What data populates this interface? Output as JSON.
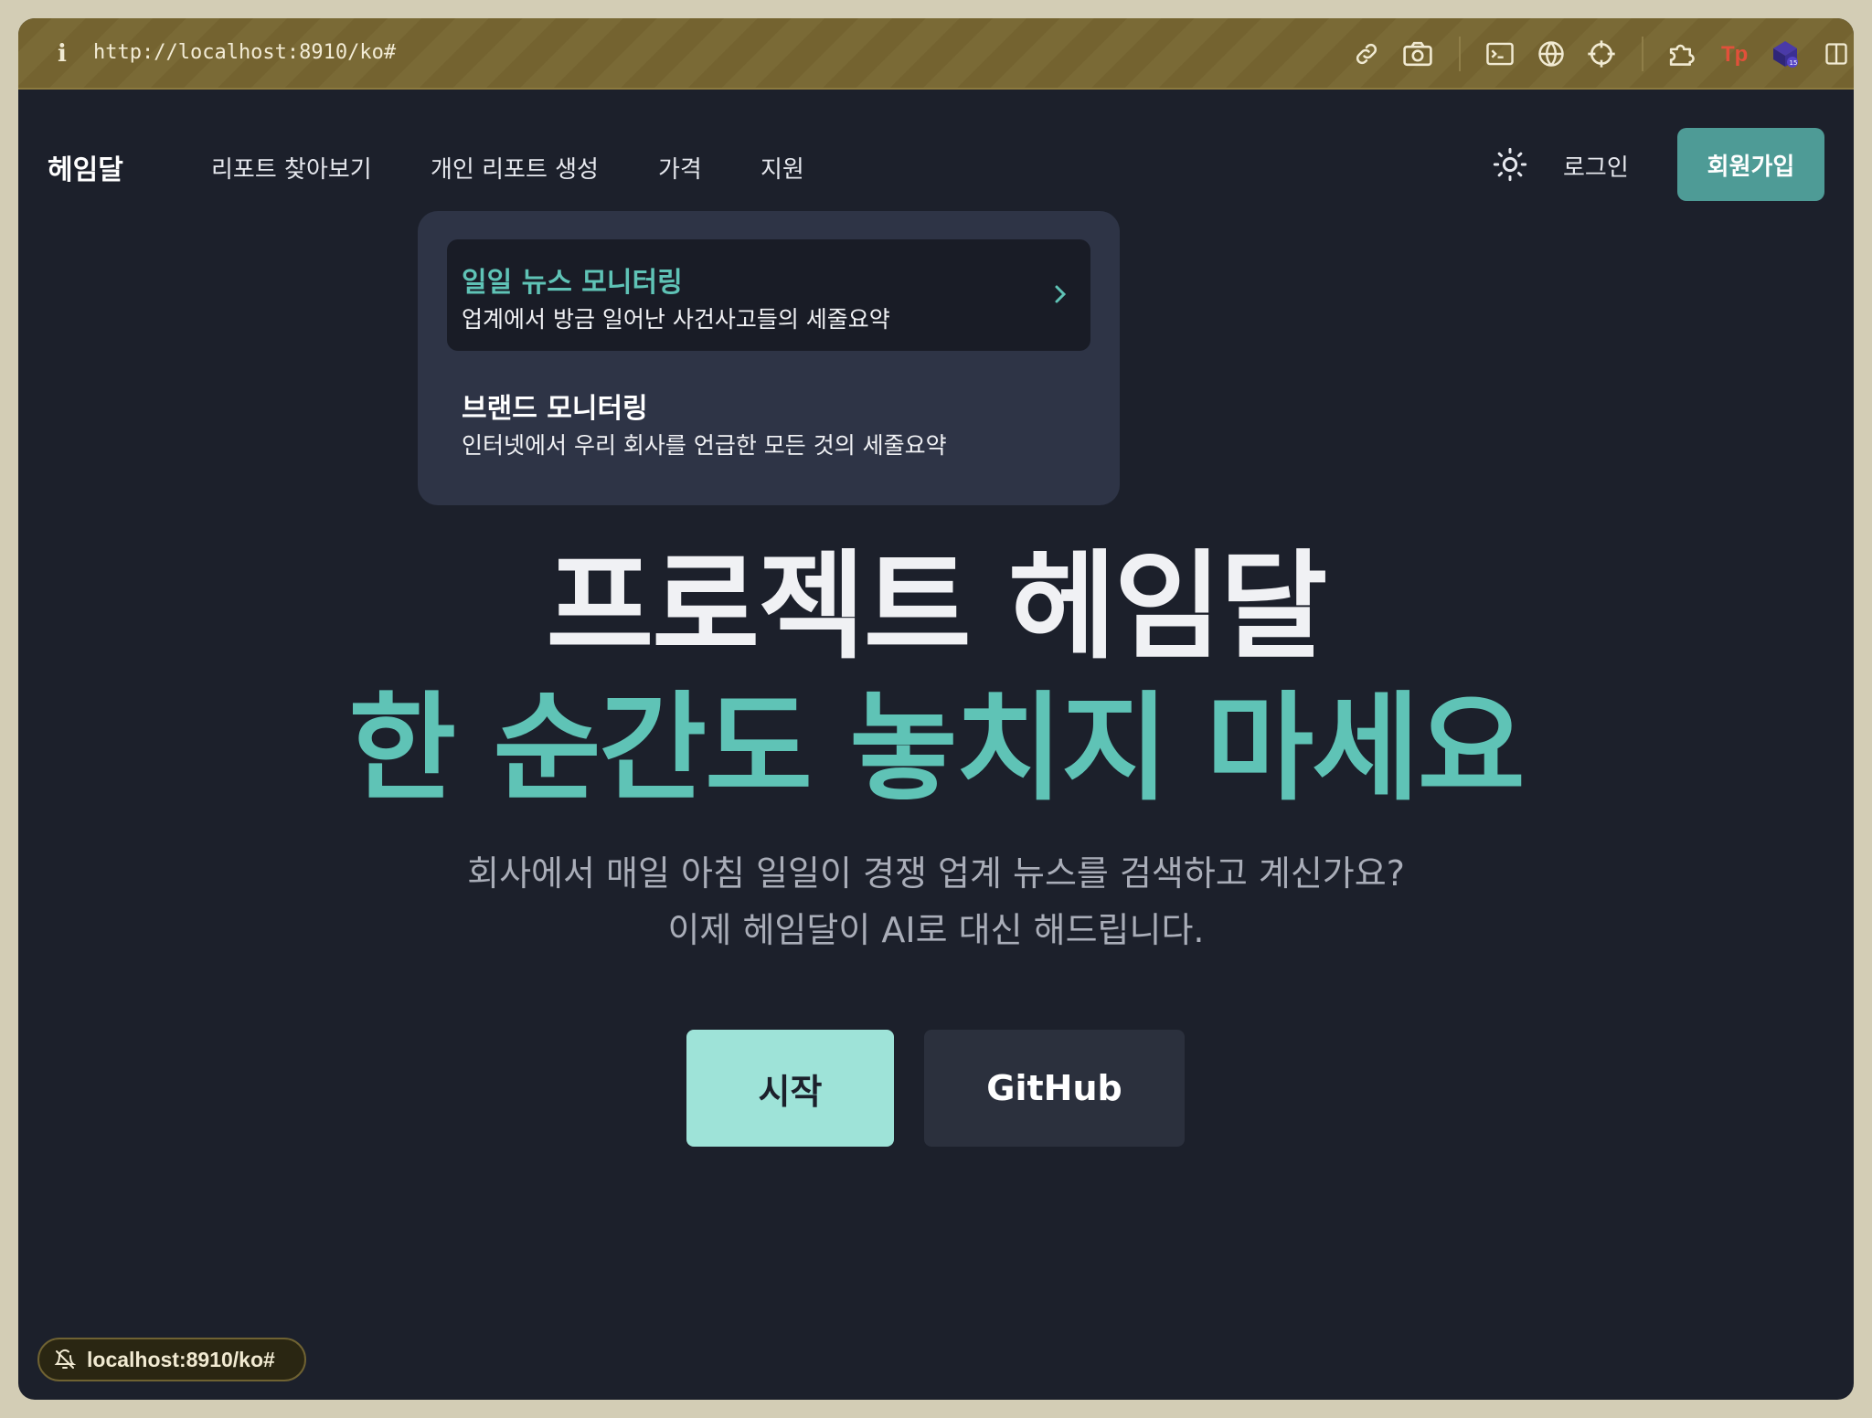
{
  "browser": {
    "url": "http://localhost:8910/ko#",
    "status_url": "localhost:8910/ko#",
    "icons": [
      "info-icon",
      "link-icon",
      "camera-icon",
      "terminal-icon",
      "globe-icon",
      "crosshair-icon",
      "extensions-puzzle-icon",
      "tp-extension-icon",
      "extension-cube-icon",
      "sidebar-toggle-icon"
    ]
  },
  "nav": {
    "brand": "헤임달",
    "items": [
      "리포트 찾아보기",
      "개인 리포트 생성",
      "가격",
      "지원"
    ],
    "login": "로그인",
    "signup": "회원가입"
  },
  "dropdown": {
    "items": [
      {
        "title": "일일 뉴스 모니터링",
        "desc": "업계에서 방금 일어난 사건사고들의 세줄요약",
        "active": true
      },
      {
        "title": "브랜드 모니터링",
        "desc": "인터넷에서 우리 회사를 언급한 모든 것의 세줄요약",
        "active": false
      }
    ]
  },
  "hero": {
    "title": "프로젝트 헤임달",
    "subtitle": "한 순간도 놓치지 마세요",
    "desc_line1": "회사에서 매일 아침 일일이 경쟁 업계 뉴스를 검색하고 계신가요?",
    "desc_line2": "이제 헤임달이 AI로 대신 해드립니다.",
    "start_button": "시작",
    "github_button": "GitHub"
  },
  "colors": {
    "accent": "#5fc3b6",
    "signup_bg": "#4e9b96",
    "start_bg": "#9ee3d8",
    "background": "#1c202b",
    "toolbar": "#746330"
  }
}
